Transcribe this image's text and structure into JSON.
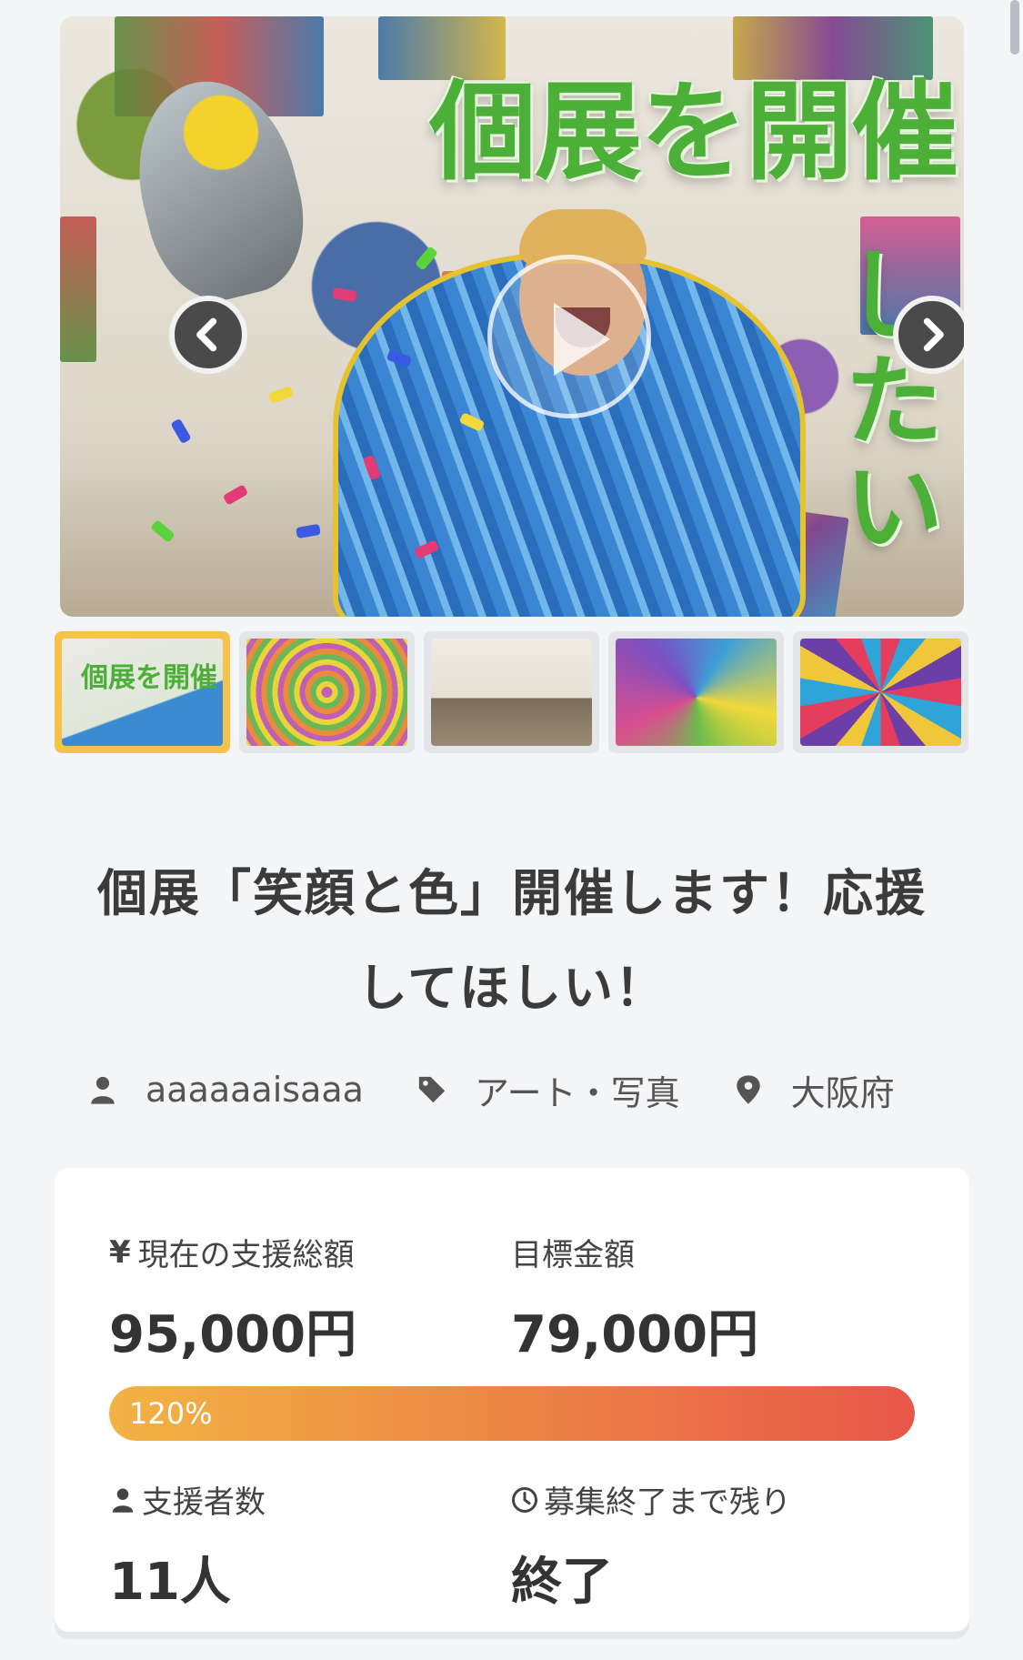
{
  "hero": {
    "overlay_title": "個展を開催",
    "overlay_subtitle_vertical": "したい",
    "prev_label": "‹",
    "next_label": "›"
  },
  "gallery": {
    "thumbnails": [
      {
        "label": "個展を開催したい",
        "active": true
      },
      {
        "label": "",
        "active": false
      },
      {
        "label": "",
        "active": false
      },
      {
        "label": "",
        "active": false
      },
      {
        "label": "",
        "active": false
      }
    ]
  },
  "project": {
    "title_line1": "個展「笑顔と色」開催します！応援",
    "title_line2": "してほしい！",
    "owner": "aaaaaaisaaa",
    "category": "アート・写真",
    "location": "大阪府"
  },
  "stats": {
    "current_label": "現在の支援総額",
    "current_value": "95,000円",
    "goal_label": "目標金額",
    "goal_value": "79,000円",
    "progress_percent": 120,
    "progress_text": "120%",
    "backers_label": "支援者数",
    "backers_value": "11人",
    "remaining_label": "募集終了まで残り",
    "remaining_value": "終了",
    "currency_icon_text": "¥"
  },
  "colors": {
    "accent_green": "#4caf38",
    "progress_start": "#f2b344",
    "progress_end": "#e8564a",
    "active_thumb_border": "#f5c24b"
  }
}
